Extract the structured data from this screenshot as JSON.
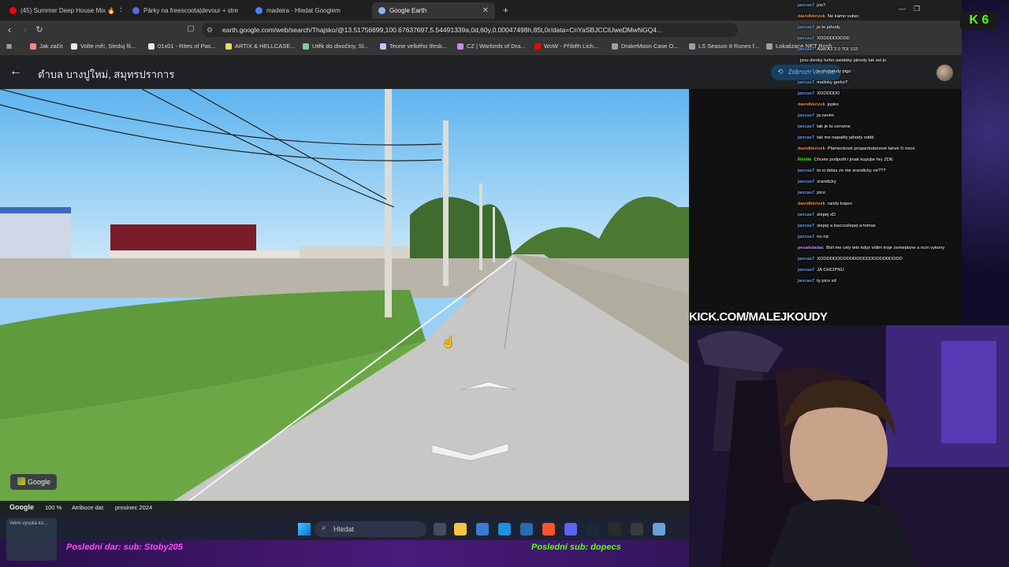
{
  "tabs": [
    {
      "label": "(45) Summer Deep House Mix 🔥",
      "color": "#ff0000"
    },
    {
      "label": "Párky na freescoota|devour + stre",
      "color": "#5865f2"
    },
    {
      "label": "madeira - Hledat Googlem",
      "color": "#4285f4"
    },
    {
      "label": "Google Earth",
      "color": "#8ab4f8",
      "active": true
    }
  ],
  "new_tab": "+",
  "address": "earth.google.com/web/search/Thajsko/@13.51756699,100.67637697,5.54491339a,0d,60y,0.00047498h,85t,0r/data=CnYaSBJCCiUweDMwNGQ4...",
  "bookmarks": [
    {
      "label": "Jak začít",
      "color": "#f28b82"
    },
    {
      "label": "Volte mě!, Sleduj fil...",
      "color": "#e8eaed"
    },
    {
      "label": "01x01 - Rites of Pas...",
      "color": "#e8eaed"
    },
    {
      "label": "ARTIX & HELLCASE...",
      "color": "#fdd663"
    },
    {
      "label": "Utěk do divočiny, Sl...",
      "color": "#81c995"
    },
    {
      "label": "Teorie velkého třesk...",
      "color": "#aecbfa"
    },
    {
      "label": "CZ | Warlords of Dra...",
      "color": "#c58af9"
    },
    {
      "label": "WoW - Příběh Lich...",
      "color": "#ff0000"
    },
    {
      "label": "DrakeMoon Case O...",
      "color": "#9aa0a6"
    },
    {
      "label": "LS Season 8 Runes f...",
      "color": "#9aa0a6"
    },
    {
      "label": "Lokalizace NET Bosh...",
      "color": "#9aa0a6"
    }
  ],
  "earth": {
    "title": "ตำบล บางปูใหม่, สมุทรปราการ",
    "more_button": "Zobrazit více dat",
    "google_badge": "Google",
    "status": {
      "logo": "Google",
      "zoom": "100 %",
      "attribution": "Atribuce dat",
      "date": "prosinec 2024"
    }
  },
  "taskbar": {
    "search": "Hledat"
  },
  "stream": {
    "kick_url": "KICK.COM/MALEJKOUDY",
    "kick_count": "6",
    "last_donation": "Poslední dar: sub: Stoby205",
    "last_sub": "Poslední sub: dopecs",
    "notification": "Velmi vysoká ko..."
  },
  "chat": [
    {
      "user": "jancas7",
      "msg": "joo?",
      "color": "#5aa0ff"
    },
    {
      "user": "davidkkrizek",
      "msg": "Ne kamo vubec",
      "color": "#ff8a3a"
    },
    {
      "user": "jancas7",
      "msg": "je to jahody",
      "color": "#5aa0ff"
    },
    {
      "user": "jancas7",
      "msg": "XDDDDDDDDD",
      "color": "#5aa0ff"
    },
    {
      "user": "jancas7",
      "msg": "Audi A3 2.0 TDI 103",
      "color": "#5aa0ff"
    },
    {
      "user": "",
      "msg": "jsou divoky turbo asiatsky jahody tak asi jo",
      "color": "#ffffff"
    },
    {
      "user": "jancas7",
      "msg": "je chcipnuty pigo",
      "color": "#5aa0ff"
    },
    {
      "user": "jancas7",
      "msg": "malinky gerko?",
      "color": "#5aa0ff"
    },
    {
      "user": "jancas7",
      "msg": "XDDDDDD",
      "color": "#5aa0ff"
    },
    {
      "user": "davidkkrizek",
      "msg": "jopko",
      "color": "#ff8a3a"
    },
    {
      "user": "jancas7",
      "msg": "ja nevim",
      "color": "#5aa0ff"
    },
    {
      "user": "jancas7",
      "msg": "tak je to cervene",
      "color": "#5aa0ff"
    },
    {
      "user": "jancas7",
      "msg": "tak me napadly jahody xddd",
      "color": "#5aa0ff"
    },
    {
      "user": "davidkkrizek",
      "msg": "Plamenkové propanbutanové lahve či nece",
      "color": "#ff8a3a"
    },
    {
      "user": "Renlie",
      "msg": "Chcete podpořit i jinak kupujte hry ZDE",
      "color": "#53fc18"
    },
    {
      "user": "jancas7",
      "msg": "to si delas ze me srandicky ne???",
      "color": "#5aa0ff"
    },
    {
      "user": "jancas7",
      "msg": "srandicky",
      "color": "#5aa0ff"
    },
    {
      "user": "jancas7",
      "msg": "pico",
      "color": "#5aa0ff"
    },
    {
      "user": "davidkkrizek",
      "msg": "randy kopec",
      "color": "#ff8a3a"
    },
    {
      "user": "jancas7",
      "msg": "slepej xD",
      "color": "#5aa0ff"
    },
    {
      "user": "jancas7",
      "msg": "slepej a baccoslepej a tomas",
      "color": "#5aa0ff"
    },
    {
      "user": "jancas7",
      "msg": "no nic",
      "color": "#5aa0ff"
    },
    {
      "user": "pesakdadac",
      "msg": "Boli me cely telo kdyz vidim troje zemepisne a ocni vykony",
      "color": "#c58af9"
    },
    {
      "user": "jancas7",
      "msg": "XDDDDDDDDDDDDDDDDDDDDDDDDD",
      "color": "#5aa0ff"
    },
    {
      "user": "jancas7",
      "msg": "JA CHCIPNU",
      "color": "#5aa0ff"
    },
    {
      "user": "jancas7",
      "msg": "ty pico xd",
      "color": "#5aa0ff"
    }
  ]
}
